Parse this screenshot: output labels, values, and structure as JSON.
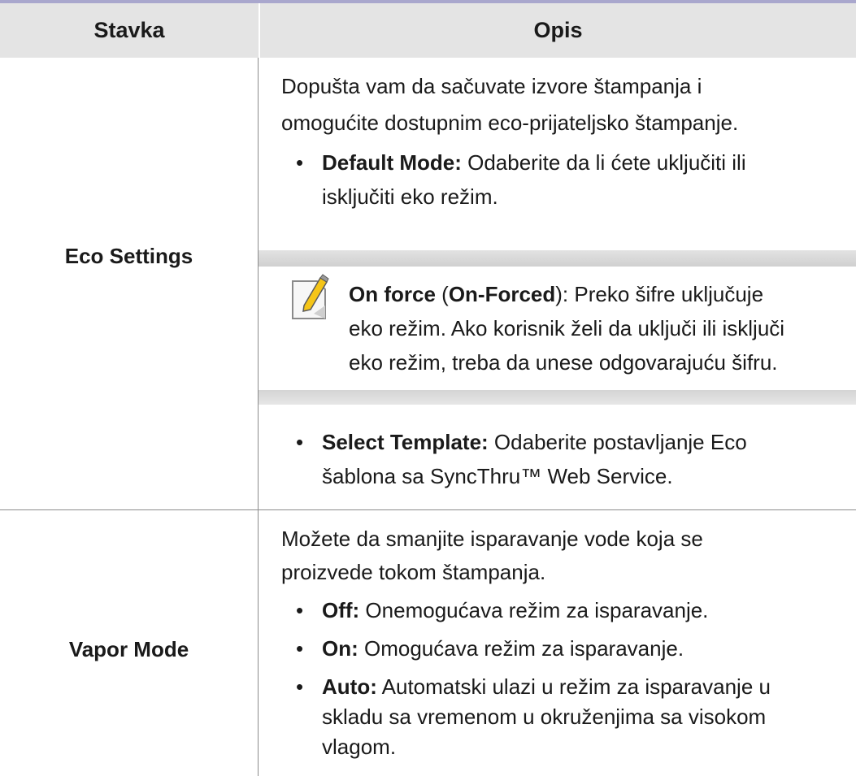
{
  "header": {
    "col_item": "Stavka",
    "col_desc": "Opis"
  },
  "eco": {
    "label": "Eco Settings",
    "intro_line1": "Dopušta vam da sačuvate izvore štampanja i",
    "intro_line2": "omogućite dostupnim eco-prijateljsko štampanje.",
    "bullet_char": "•",
    "default_mode_term": "Default Mode:",
    "default_mode_line1": " Odaberite da li ćete uključiti ili",
    "default_mode_line2": "isključiti eko režim.",
    "note_term": "On force",
    "note_paren_open": " (",
    "note_term2": "On-Forced",
    "note_line1_rest": "): Preko šifre uključuje",
    "note_line2": "eko režim. Ako korisnik želi da uključi ili isključi",
    "note_line3": "eko režim, treba da unese odgovarajuću šifru.",
    "template_term": "Select Template:",
    "template_line1": " Odaberite postavljanje Eco",
    "template_line2": "šablona sa SyncThru™ Web Service."
  },
  "vapor": {
    "label": "Vapor Mode",
    "intro_line1": "Možete da smanjite isparavanje vode koja se",
    "intro_line2": "proizvede tokom štampanja.",
    "bullet_char": "•",
    "off_term": "Off:",
    "off_text": " Onemogućava režim za isparavanje.",
    "on_term": "On:",
    "on_text": " Omogućava režim za isparavanje.",
    "auto_term": "Auto:",
    "auto_line1": " Automatski ulazi u režim za isparavanje u",
    "auto_line2": "skladu sa vremenom u okruženjima sa visokom",
    "auto_line3": "vlagom."
  },
  "colors": {
    "header_bg": "#e4e4e4",
    "top_rule": "#a9a7cd",
    "note_band": "#d8d8d8"
  },
  "icons": {
    "note": "note-pencil-icon"
  }
}
